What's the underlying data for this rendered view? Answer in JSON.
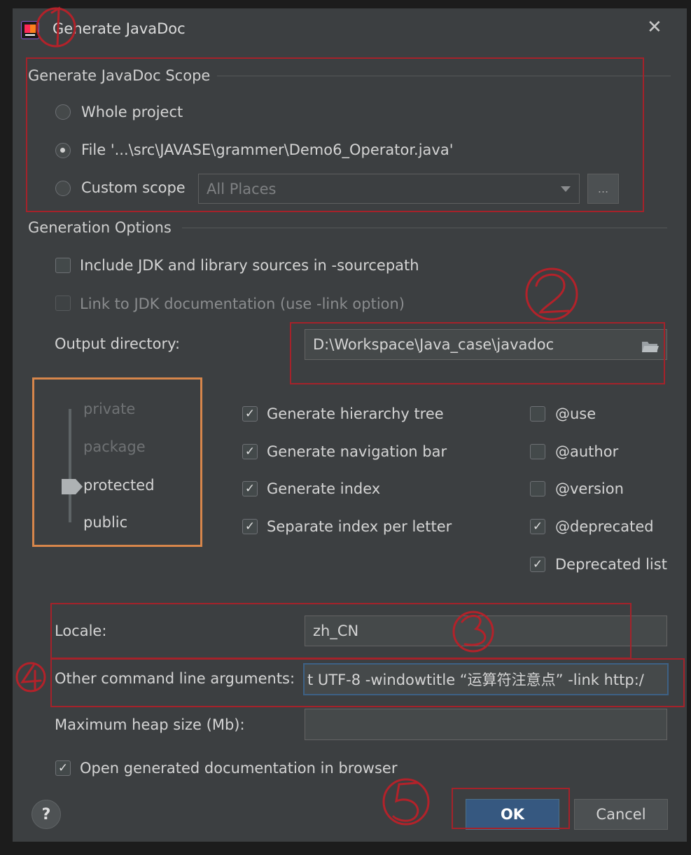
{
  "dialog": {
    "title": "Generate JavaDoc",
    "close_glyph": "✕",
    "app_icon": "intellij-icon"
  },
  "scope": {
    "section_title": "Generate JavaDoc Scope",
    "whole_project": "Whole project",
    "file": "File '...\\src\\JAVASE\\grammer\\Demo6_Operator.java'",
    "custom_scope": "Custom scope",
    "custom_scope_value": "All Places",
    "browse_label": "...",
    "selected": "file"
  },
  "options": {
    "section_title": "Generation Options",
    "include_jdk": "Include JDK and library sources in -sourcepath",
    "link_jdk": "Link to JDK documentation (use -link option)",
    "output_dir_label": "Output directory:",
    "output_dir_value": "D:\\Workspace\\Java_case\\javadoc"
  },
  "visibility": {
    "levels": [
      "private",
      "package",
      "protected",
      "public"
    ],
    "selected": "protected"
  },
  "generate": {
    "hierarchy_tree": "Generate hierarchy tree",
    "navigation_bar": "Generate navigation bar",
    "index": "Generate index",
    "separate_index": "Separate index per letter"
  },
  "tags": {
    "use": "@use",
    "author": "@author",
    "version": "@version",
    "deprecated": "@deprecated",
    "deprecated_list": "Deprecated list"
  },
  "bottom": {
    "locale_label": "Locale:",
    "locale_value": "zh_CN",
    "other_args_label": "Other command line arguments:",
    "other_args_value": "t UTF-8 -windowtitle “运算符注意点” -link http:/",
    "heap_label": "Maximum heap size (Mb):",
    "heap_value": "",
    "open_browser": "Open generated documentation in browser"
  },
  "buttons": {
    "help": "?",
    "ok": "OK",
    "cancel": "Cancel"
  },
  "check": "✓",
  "colors": {
    "dialog_bg": "#3c3f41",
    "annotation_red": "#a5222a",
    "annotation_orange": "#d7864b",
    "primary_button": "#365880"
  }
}
